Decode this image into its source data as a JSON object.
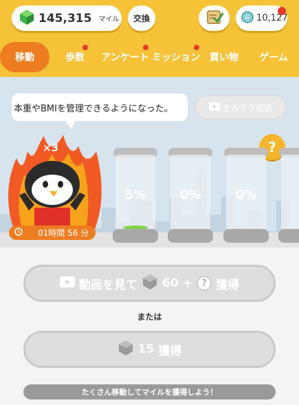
{
  "header": {
    "miles_value": "145,315",
    "miles_unit": "マイル",
    "exchange_label": "交換",
    "coin_value": "10,127"
  },
  "tabs": [
    {
      "label": "移動",
      "active": true,
      "badge": false
    },
    {
      "label": "歩数",
      "active": false,
      "badge": true
    },
    {
      "label": "アンケート",
      "active": false,
      "badge": true
    },
    {
      "label": "ミッション",
      "active": false,
      "badge": true
    },
    {
      "label": "買い物",
      "active": false,
      "badge": false
    },
    {
      "label": "ゲーム",
      "active": false,
      "badge": false
    }
  ],
  "scene": {
    "speech_text": "本重やBMIを管理できるようになった。",
    "triple_button_label": "をみて３倍速",
    "multiplier_text": "×3",
    "help_label": "?",
    "timer_value": "01時間 56 分",
    "jars": [
      {
        "label": "5%",
        "fill_percent": 5
      },
      {
        "label": "0%",
        "fill_percent": 0
      },
      {
        "label": "0%",
        "fill_percent": 0
      },
      {
        "label": "",
        "fill_percent": 0
      }
    ]
  },
  "actions": {
    "video_label": "動画を見て",
    "video_amount": "60",
    "video_plus": "+",
    "video_earn": "獲得",
    "or_text": "または",
    "gem_amount": "15",
    "gem_earn": "獲得",
    "hint_text": "たくさん移動してマイルを獲得しよう！"
  },
  "colors": {
    "header_bg": "#f6c238",
    "active_tab": "#ee7d22",
    "badge": "#e43a2a",
    "disabled": "#dedede"
  }
}
